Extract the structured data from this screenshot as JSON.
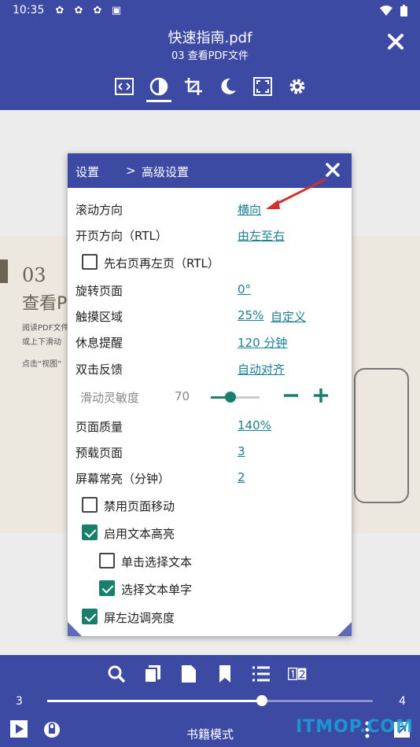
{
  "status_bar": {
    "time": "10:35"
  },
  "header": {
    "title": "快速指南.pdf",
    "subtitle": "03 查看PDF文件"
  },
  "toolbar_icons": [
    "crop-fit-icon",
    "contrast-icon",
    "crop-icon",
    "night-mode-icon",
    "fullscreen-icon",
    "settings-icon"
  ],
  "pdf_page": {
    "number": "03",
    "heading": "查看P",
    "line1": "阅读PDF文件",
    "line2": "或上下滑动",
    "line3": "点击“视图”"
  },
  "dialog": {
    "breadcrumb_root": "设置",
    "breadcrumb_sep": ">",
    "breadcrumb_current": "高级设置",
    "rows": {
      "scroll_dir": {
        "label": "滚动方向",
        "value": "横向"
      },
      "page_dir": {
        "label": "开页方向（RTL）",
        "value": "由左至右"
      },
      "rotate": {
        "label": "旋转页面",
        "value": "0°"
      },
      "touch": {
        "label": "触摸区域",
        "value": "25%",
        "value2": "自定义"
      },
      "rest": {
        "label": "休息提醒",
        "value": "120 分钟"
      },
      "double_tap": {
        "label": "双击反馈",
        "value": "自动对齐"
      },
      "quality": {
        "label": "页面质量",
        "value": "140%"
      },
      "preload": {
        "label": "预载页面",
        "value": "3"
      },
      "screen_on": {
        "label": "屏幕常亮（分钟）",
        "value": "2"
      }
    },
    "slider": {
      "label": "滑动灵敏度",
      "value": "70",
      "level": 0.4
    },
    "checkboxes": {
      "right_first": {
        "label": "先右页再左页（RTL）",
        "checked": false
      },
      "disable_move": {
        "label": "禁用页面移动",
        "checked": false
      },
      "text_highlight": {
        "label": "启用文本高亮",
        "checked": true
      },
      "single_tap_select": {
        "label": "单击选择文本",
        "checked": false
      },
      "select_word": {
        "label": "选择文本单字",
        "checked": true
      },
      "left_brightness": {
        "label": "屏左边调亮度",
        "checked": true
      }
    }
  },
  "bottom_bar": {
    "page_start": "3",
    "page_end": "4",
    "progress": 0.66,
    "mode_label": "书籍模式",
    "tool_icons": [
      "search-icon",
      "copy-icon",
      "page-icon",
      "bookmark-icon",
      "list-icon",
      "two-page-icon"
    ]
  },
  "watermark": "ITMOP.COM",
  "colors": {
    "primary": "#3d4aa3",
    "accent": "#1a7f6a",
    "link": "#1a7f95",
    "annotation": "#d32f2f"
  }
}
